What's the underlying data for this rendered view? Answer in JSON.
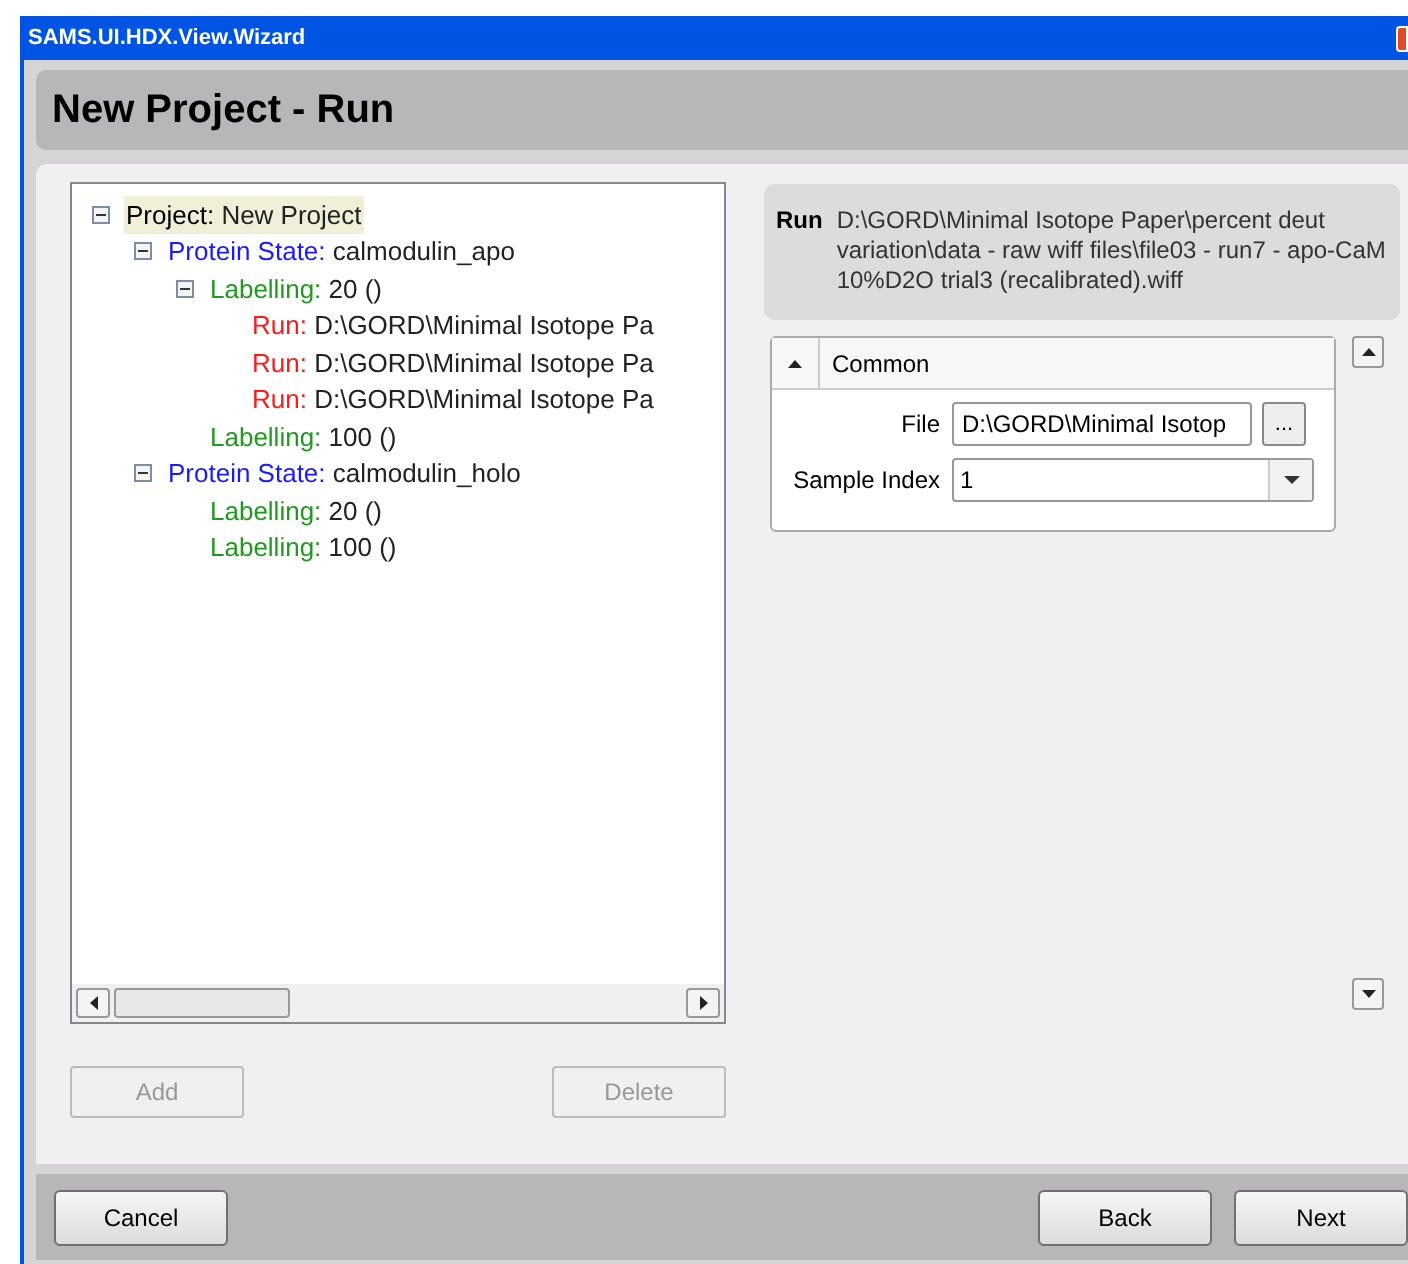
{
  "window": {
    "title": "SAMS.UI.HDX.View.Wizard"
  },
  "header": {
    "title": "New Project - Run"
  },
  "tree": [
    {
      "kind": "project",
      "prefix": "Project:",
      "value": "New Project",
      "selected": true,
      "expanded": true,
      "children": [
        {
          "kind": "protein",
          "prefix": "Protein State:",
          "value": "calmodulin_apo",
          "selected": false,
          "expanded": true,
          "children": [
            {
              "kind": "labelling",
              "prefix": "Labelling:",
              "value": "20 ()",
              "selected": false,
              "expanded": true,
              "children": [
                {
                  "kind": "run",
                  "prefix": "Run:",
                  "value": "D:\\GORD\\Minimal Isotope Pa",
                  "selected": false
                },
                {
                  "kind": "run",
                  "prefix": "Run:",
                  "value": "D:\\GORD\\Minimal Isotope Pa",
                  "selected": false
                },
                {
                  "kind": "run",
                  "prefix": "Run:",
                  "value": "D:\\GORD\\Minimal Isotope Pa",
                  "selected": false
                }
              ]
            },
            {
              "kind": "labelling",
              "prefix": "Labelling:",
              "value": "100 ()",
              "selected": false
            }
          ]
        },
        {
          "kind": "protein",
          "prefix": "Protein State:",
          "value": "calmodulin_holo",
          "selected": false,
          "expanded": true,
          "children": [
            {
              "kind": "labelling",
              "prefix": "Labelling:",
              "value": "20 ()",
              "selected": false
            },
            {
              "kind": "labelling",
              "prefix": "Labelling:",
              "value": "100 ()",
              "selected": false
            }
          ]
        }
      ]
    }
  ],
  "tree_buttons": [
    {
      "label": "Add",
      "disabled": true
    },
    {
      "label": "Delete",
      "disabled": true
    }
  ],
  "run_info": {
    "label": "Run",
    "value": "D:\\GORD\\Minimal Isotope Paper\\percent deut variation\\data - raw wiff files\\file03 - run7 - apo-CaM 10%D2O trial3 (recalibrated).wiff"
  },
  "property_grid": {
    "category": "Common",
    "expanded": true,
    "properties": [
      {
        "kind": "file",
        "label": "File",
        "value": "D:\\GORD\\Minimal Isotop",
        "button": "..."
      },
      {
        "kind": "dropdown",
        "label": "Sample Index",
        "value": "1"
      }
    ]
  },
  "footer_buttons": [
    {
      "label": "Cancel"
    },
    {
      "label": "Back"
    },
    {
      "label": "Next"
    }
  ]
}
